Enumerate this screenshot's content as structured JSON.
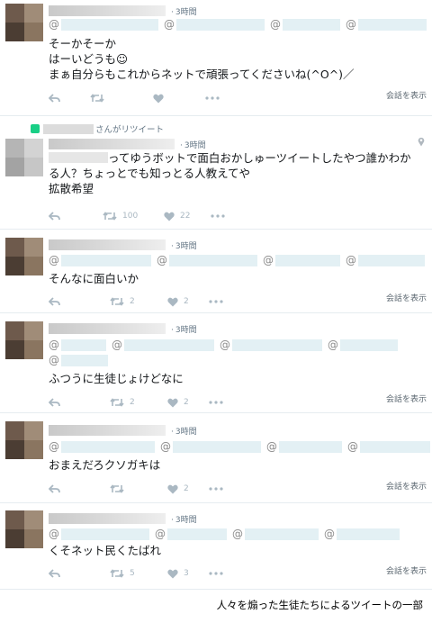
{
  "colors": {
    "mention_bg": "#e3f0f4",
    "retweet_green": "#19cf86",
    "meta_text": "#657786",
    "icon_gray": "#aab8c2"
  },
  "tweets": [
    {
      "time": "3時間",
      "mentions_row1": [
        "@",
        "@",
        "@",
        "@"
      ],
      "lines": [
        "そーかそーか",
        "はーいどうも☺",
        "まぁ自分らもこれからネットで頑張ってくださいね(^O^)／"
      ],
      "retweets": "",
      "likes": "",
      "reply_link": "会話を表示"
    },
    {
      "retweet_label": "さんがリツイート",
      "time": "3時間",
      "lines": [
        "ってゆうボットで面白おかしゅーツイートしたやつ誰かわか",
        "る人？ちょっとでも知っとる人教えてや",
        "拡散希望"
      ],
      "retweets": "100",
      "likes": "22"
    },
    {
      "time": "3時間",
      "mentions_row1": [
        "@",
        "@",
        "@",
        "@"
      ],
      "lines": [
        "そんなに面白いか"
      ],
      "retweets": "2",
      "likes": "2",
      "reply_link": "会話を表示"
    },
    {
      "time": "3時間",
      "mentions_row1": [
        "@",
        "@",
        "@",
        "@"
      ],
      "mentions_row2": [
        "@"
      ],
      "lines": [
        "ふつうに生徒じょけどなに"
      ],
      "retweets": "2",
      "likes": "2",
      "reply_link": "会話を表示"
    },
    {
      "time": "3時間",
      "mentions_row1": [
        "@",
        "@",
        "@",
        "@"
      ],
      "lines": [
        "おまえだろクソガキは"
      ],
      "retweets": "",
      "likes": "2",
      "reply_link": "会話を表示"
    },
    {
      "time": "3時間",
      "mentions_row1": [
        "@",
        "@",
        "@",
        "@"
      ],
      "lines": [
        "くそネット民くたばれ"
      ],
      "retweets": "5",
      "likes": "3",
      "reply_link": "会話を表示"
    }
  ],
  "caption": "人々を煽った生徒たちによるツイートの一部",
  "icons": [
    "reply-icon",
    "retweet-icon",
    "like-icon",
    "more-icon",
    "location-pin-icon"
  ]
}
